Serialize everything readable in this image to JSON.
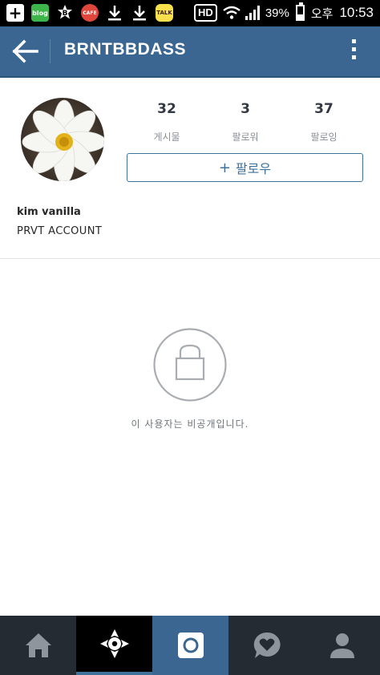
{
  "status_bar": {
    "notification_icons": [
      "add-icon",
      "blog-icon",
      "band-icon",
      "cafe-icon",
      "download-icon",
      "download-icon",
      "kakaotalk-icon"
    ],
    "blog_label": "blog",
    "band_label": "B",
    "cafe_label": "CAFE",
    "talk_label": "TALK",
    "hd_label": "HD",
    "battery_percent": "39%",
    "battery_level": 0.39,
    "ampm": "오후",
    "time": "10:53"
  },
  "header": {
    "username": "BRNTBBDASS",
    "back_icon": "arrow-left-icon",
    "more_icon": "more-vertical-icon",
    "background_color": "#3a6691"
  },
  "profile": {
    "avatar_description": "white-flower-avatar",
    "stats": [
      {
        "count": "32",
        "label": "게시물"
      },
      {
        "count": "3",
        "label": "팔로워"
      },
      {
        "count": "37",
        "label": "팔로잉"
      }
    ],
    "follow_button": {
      "plus": "+",
      "label": "팔로우"
    },
    "full_name": "kim vanilla",
    "bio": "PRVT ACCOUNT"
  },
  "private_notice": {
    "icon": "lock-icon",
    "text": "이 사용자는 비공개입니다."
  },
  "bottom_nav": {
    "items": [
      {
        "name": "home",
        "icon": "home-icon"
      },
      {
        "name": "explore",
        "icon": "explore-icon",
        "active": true
      },
      {
        "name": "camera",
        "icon": "camera-icon"
      },
      {
        "name": "activity",
        "icon": "heart-bubble-icon"
      },
      {
        "name": "profile",
        "icon": "person-icon"
      }
    ],
    "accent_color": "#3f729b"
  }
}
